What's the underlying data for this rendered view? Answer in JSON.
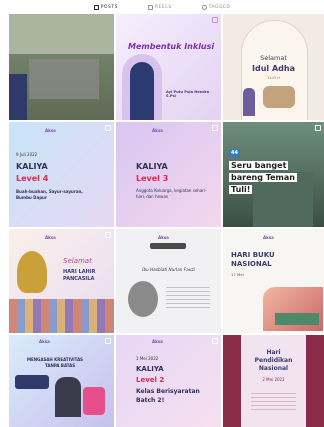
{
  "tabs": [
    {
      "label": "POSTS",
      "icon": "grid-icon"
    },
    {
      "label": "REELS",
      "icon": "reels-icon"
    },
    {
      "label": "TAGGED",
      "icon": "tagged-icon"
    }
  ],
  "brand": "Aksa",
  "posts": {
    "p2": {
      "title": "Membentuk Inklusi",
      "name": "Ayi Putu Puja Hendra S.Psi"
    },
    "p3": {
      "line1": "Selamat",
      "line2": "Idul Adha",
      "year": "1443 H"
    },
    "p4": {
      "date": "9 Juli 2022",
      "name": "KALIYA",
      "level": "Level 4",
      "desc": "Buah-buahan, Sayur-sayuran, Bumbu Dapur"
    },
    "p5": {
      "name": "KALIYA",
      "level": "Level 3",
      "desc": "Anggota Keluarga, kegiatan sehari-hari, dan hewan"
    },
    "p6": {
      "count": "44",
      "line1": "Seru banget",
      "line2": "bareng Teman",
      "line3": "Tuli!"
    },
    "p7": {
      "script": "Selamat",
      "title1": "HARI LAHIR",
      "title2": "PANCASILA"
    },
    "p8": {
      "name": "Ibu Hasbiati Nurlan Fauzi"
    },
    "p9": {
      "title1": "HARI BUKU",
      "title2": "NASIONAL",
      "date": "17 Mei"
    },
    "p10": {
      "title1": "MENGASAH KREATIVITAS",
      "title2": "TANPA BATAS"
    },
    "p11": {
      "date": "1 Mei 2022",
      "name": "KALIYA",
      "level": "Level 2",
      "desc1": "Kelas Berisyaratan",
      "desc2": "Batch 2!"
    },
    "p12": {
      "title1": "Hari",
      "title2": "Pendidikan",
      "title3": "Nasional",
      "date": "2 Mei 2022"
    }
  },
  "colors": {
    "accent_purple": "#7a2fb0",
    "level_red": "#e0284f",
    "dark_navy": "#3b3b6e"
  }
}
